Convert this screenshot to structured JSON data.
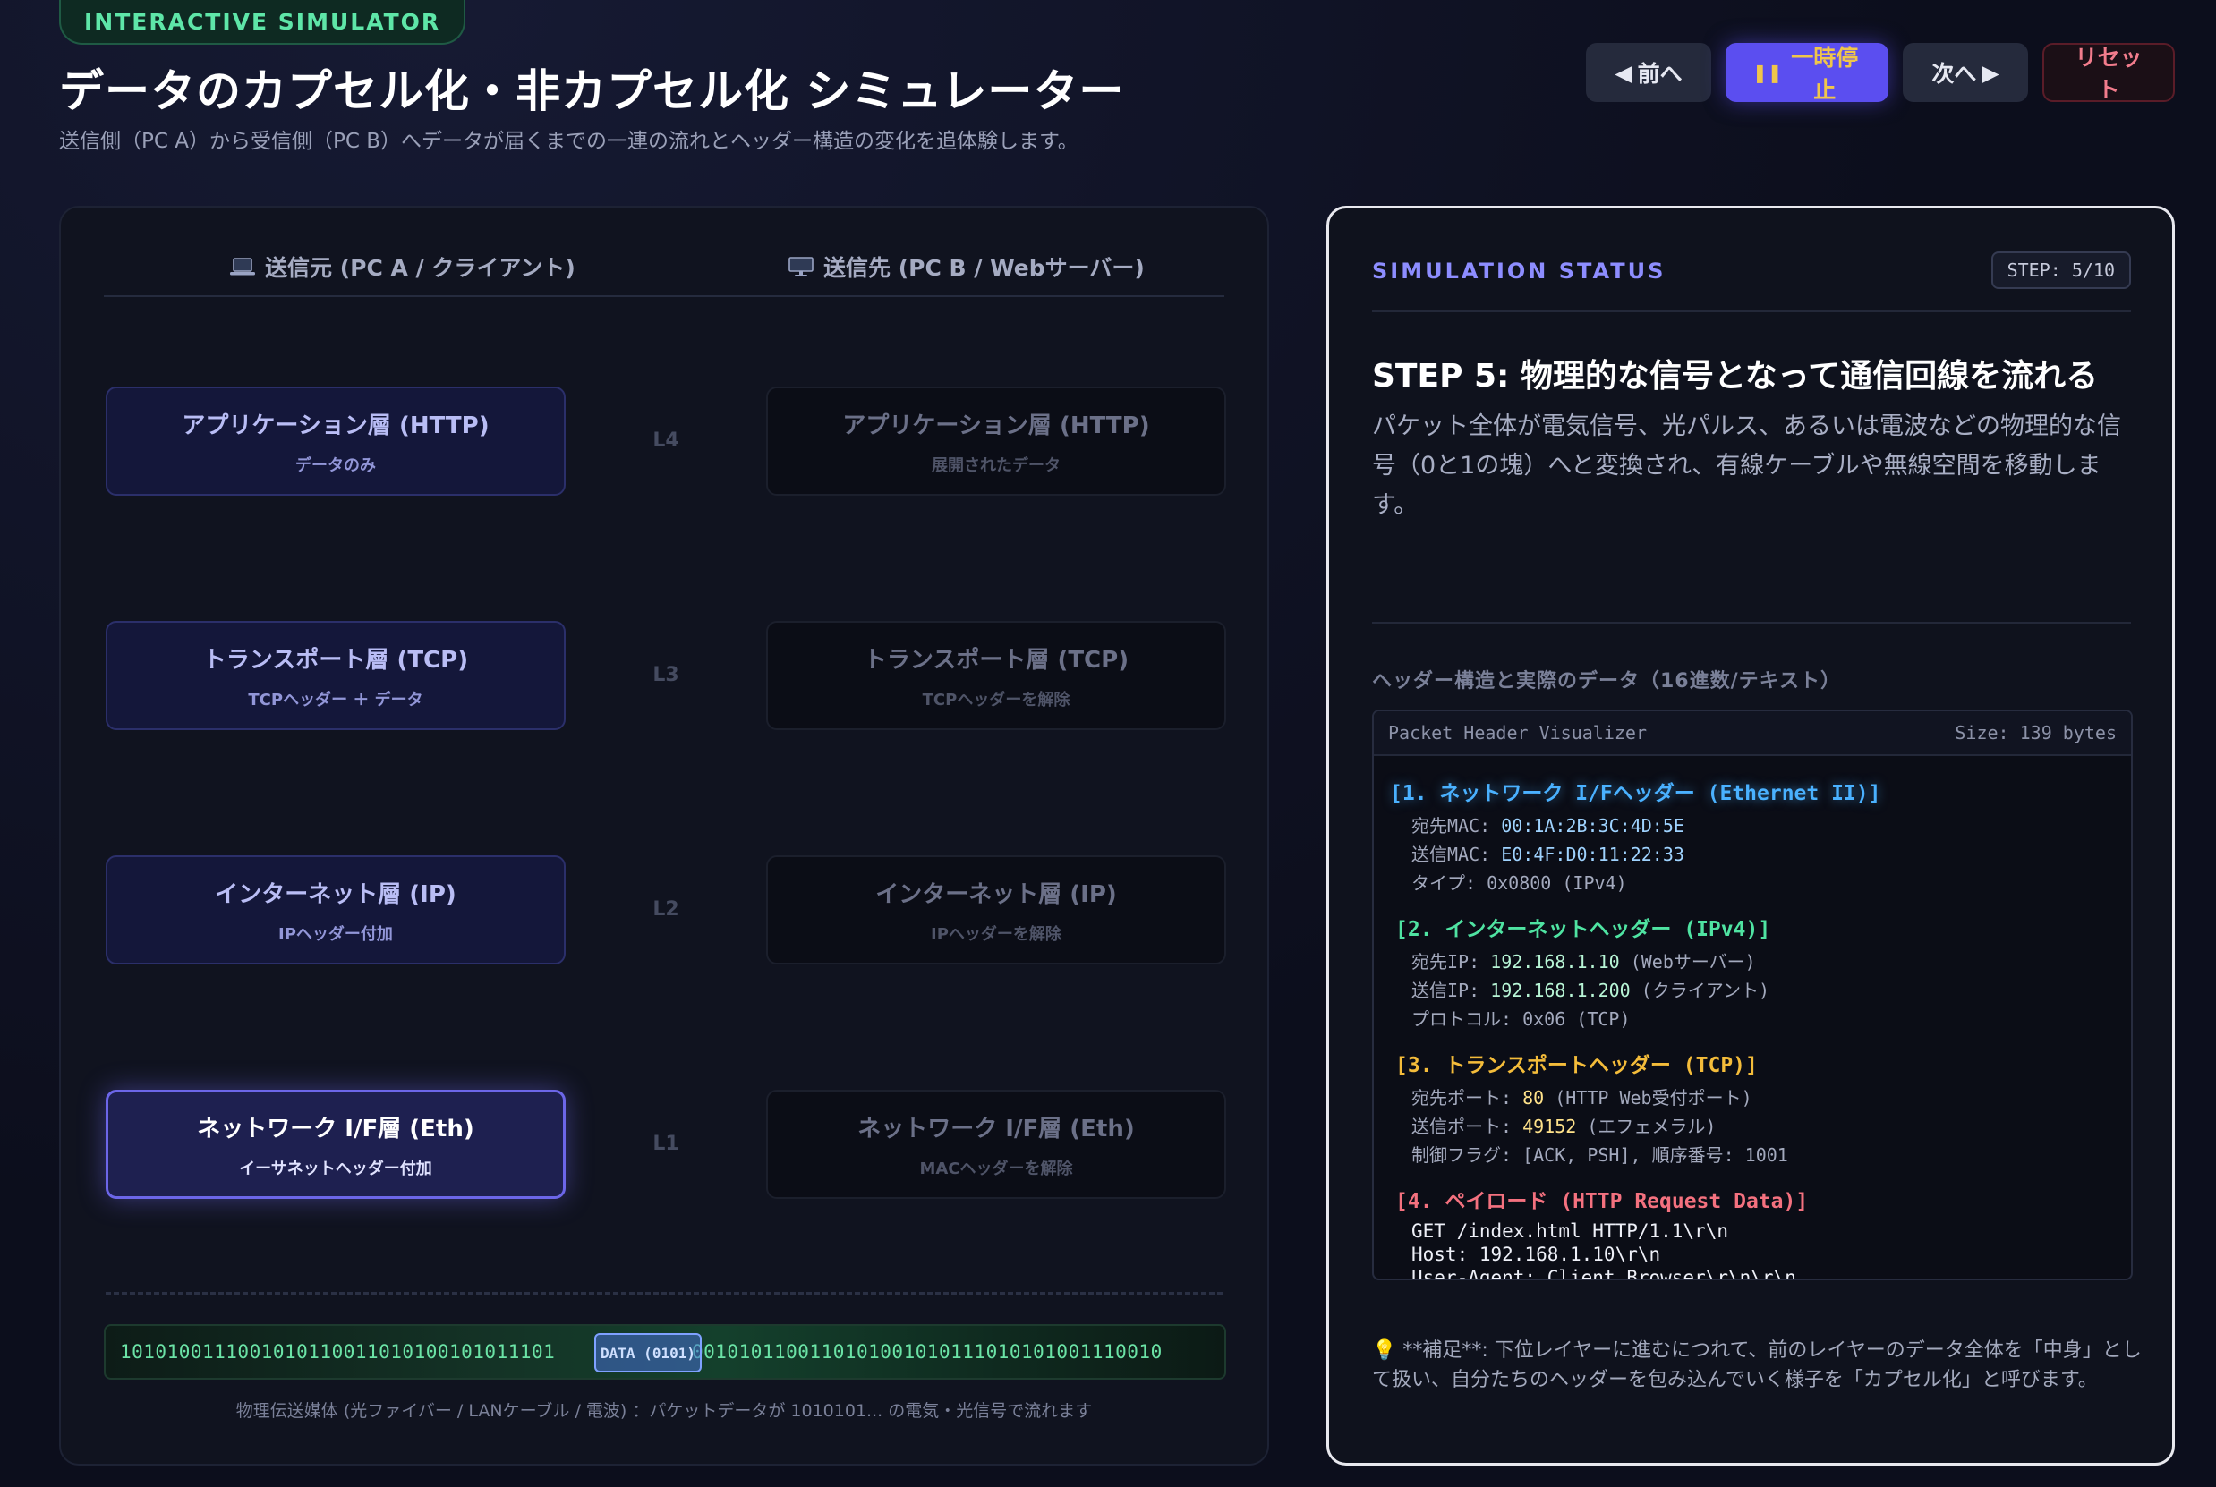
{
  "header": {
    "badge": "INTERACTIVE SIMULATOR",
    "title": "データのカプセル化・非カプセル化 シミュレーター",
    "subtitle": "送信側（PC A）から受信側（PC B）へデータが届くまでの一連の流れとヘッダー構造の変化を追体験します。"
  },
  "controls": {
    "prev": "前へ",
    "pause": "一時停止",
    "next": "次へ",
    "reset": "リセット"
  },
  "simulator": {
    "src_heading": "送信元 (PC A / クライアント)",
    "dst_heading": "送信先 (PC B / Webサーバー)",
    "layers": [
      {
        "level": "L4",
        "src_name": "アプリケーション層 (HTTP)",
        "src_desc": "データのみ",
        "dst_name": "アプリケーション層 (HTTP)",
        "dst_desc": "展開されたデータ"
      },
      {
        "level": "L3",
        "src_name": "トランスポート層 (TCP)",
        "src_desc": "TCPヘッダー ＋ データ",
        "dst_name": "トランスポート層 (TCP)",
        "dst_desc": "TCPヘッダーを解除"
      },
      {
        "level": "L2",
        "src_name": "インターネット層 (IP)",
        "src_desc": "IPヘッダー付加",
        "dst_name": "インターネット層 (IP)",
        "dst_desc": "IPヘッダーを解除"
      },
      {
        "level": "L1",
        "src_name": "ネットワーク I/F層 (Eth)",
        "src_desc": "イーサネットヘッダー付加",
        "dst_name": "ネットワーク I/F層 (Eth)",
        "dst_desc": "MACヘッダーを解除"
      }
    ],
    "bits_left": "1010100111001010110011010100101011101",
    "bits_right": "0010101100110101001010111010101001110010",
    "packet_label": "DATA (0101)",
    "medium_caption": "物理伝送媒体 (光ファイバー / LANケーブル / 電波) ：パケットデータが 1010101... の電気・光信号で流れます"
  },
  "status": {
    "label": "SIMULATION STATUS",
    "step_badge": "STEP: 5/10",
    "step_title": "STEP 5: 物理的な信号となって通信回線を流れる",
    "step_desc": "パケット全体が電気信号、光パルス、あるいは電波などの物理的な信号（0と1の塊）へと変換され、有線ケーブルや無線空間を移動します。",
    "header_label": "ヘッダー構造と実際のデータ（16進数/テキスト）",
    "visualizer": {
      "title": "Packet Header Visualizer",
      "size": "Size: 139 bytes",
      "eth": {
        "title": "[1. ネットワーク I/Fヘッダー (Ethernet II)]",
        "dst_mac_label": "宛先MAC: ",
        "dst_mac": "00:1A:2B:3C:4D:5E",
        "src_mac_label": "送信MAC: ",
        "src_mac": "E0:4F:D0:11:22:33",
        "type_label": "タイプ: ",
        "type": "0x0800 (IPv4)"
      },
      "ip": {
        "title": "[2. インターネットヘッダー (IPv4)]",
        "dst_ip_label": "宛先IP: ",
        "dst_ip": "192.168.1.10",
        "dst_ip_note": " (Webサーバー)",
        "src_ip_label": "送信IP: ",
        "src_ip": "192.168.1.200",
        "src_ip_note": " (クライアント)",
        "proto_label": "プロトコル: ",
        "proto": "0x06 (TCP)"
      },
      "tcp": {
        "title": "[3. トランスポートヘッダー (TCP)]",
        "dst_port_label": "宛先ポート: ",
        "dst_port": "80",
        "dst_port_note": " (HTTP Web受付ポート)",
        "src_port_label": "送信ポート: ",
        "src_port": "49152",
        "src_port_note": " (エフェメラル)",
        "flags": "制御フラグ: [ACK, PSH], 順序番号: 1001"
      },
      "payload": {
        "title": "[4. ペイロード (HTTP Request Data)]",
        "line1": "GET /index.html HTTP/1.1\\r\\n",
        "line2": "Host: 192.168.1.10\\r\\n",
        "line3": "User-Agent: Client Browser\\r\\n\\r\\n"
      }
    },
    "note": "💡 **補足**: 下位レイヤーに進むにつれて、前のレイヤーのデータ全体を「中身」として扱い、自分たちのヘッダーを包み込んでいく様子を「カプセル化」と呼びます。"
  },
  "icons": {
    "prev": "triangle-left-icon",
    "pause": "pause-icon",
    "next": "triangle-right-icon",
    "src_pc": "laptop-icon",
    "dst_pc": "desktop-icon",
    "note": "lightbulb-icon"
  },
  "colors": {
    "accent": "#5b4ef0",
    "eth": "#4ab1ff",
    "ip": "#4fe3a2",
    "tcp": "#f4bc3a",
    "payload": "#f4717f",
    "badge": "#5ee6a8"
  }
}
